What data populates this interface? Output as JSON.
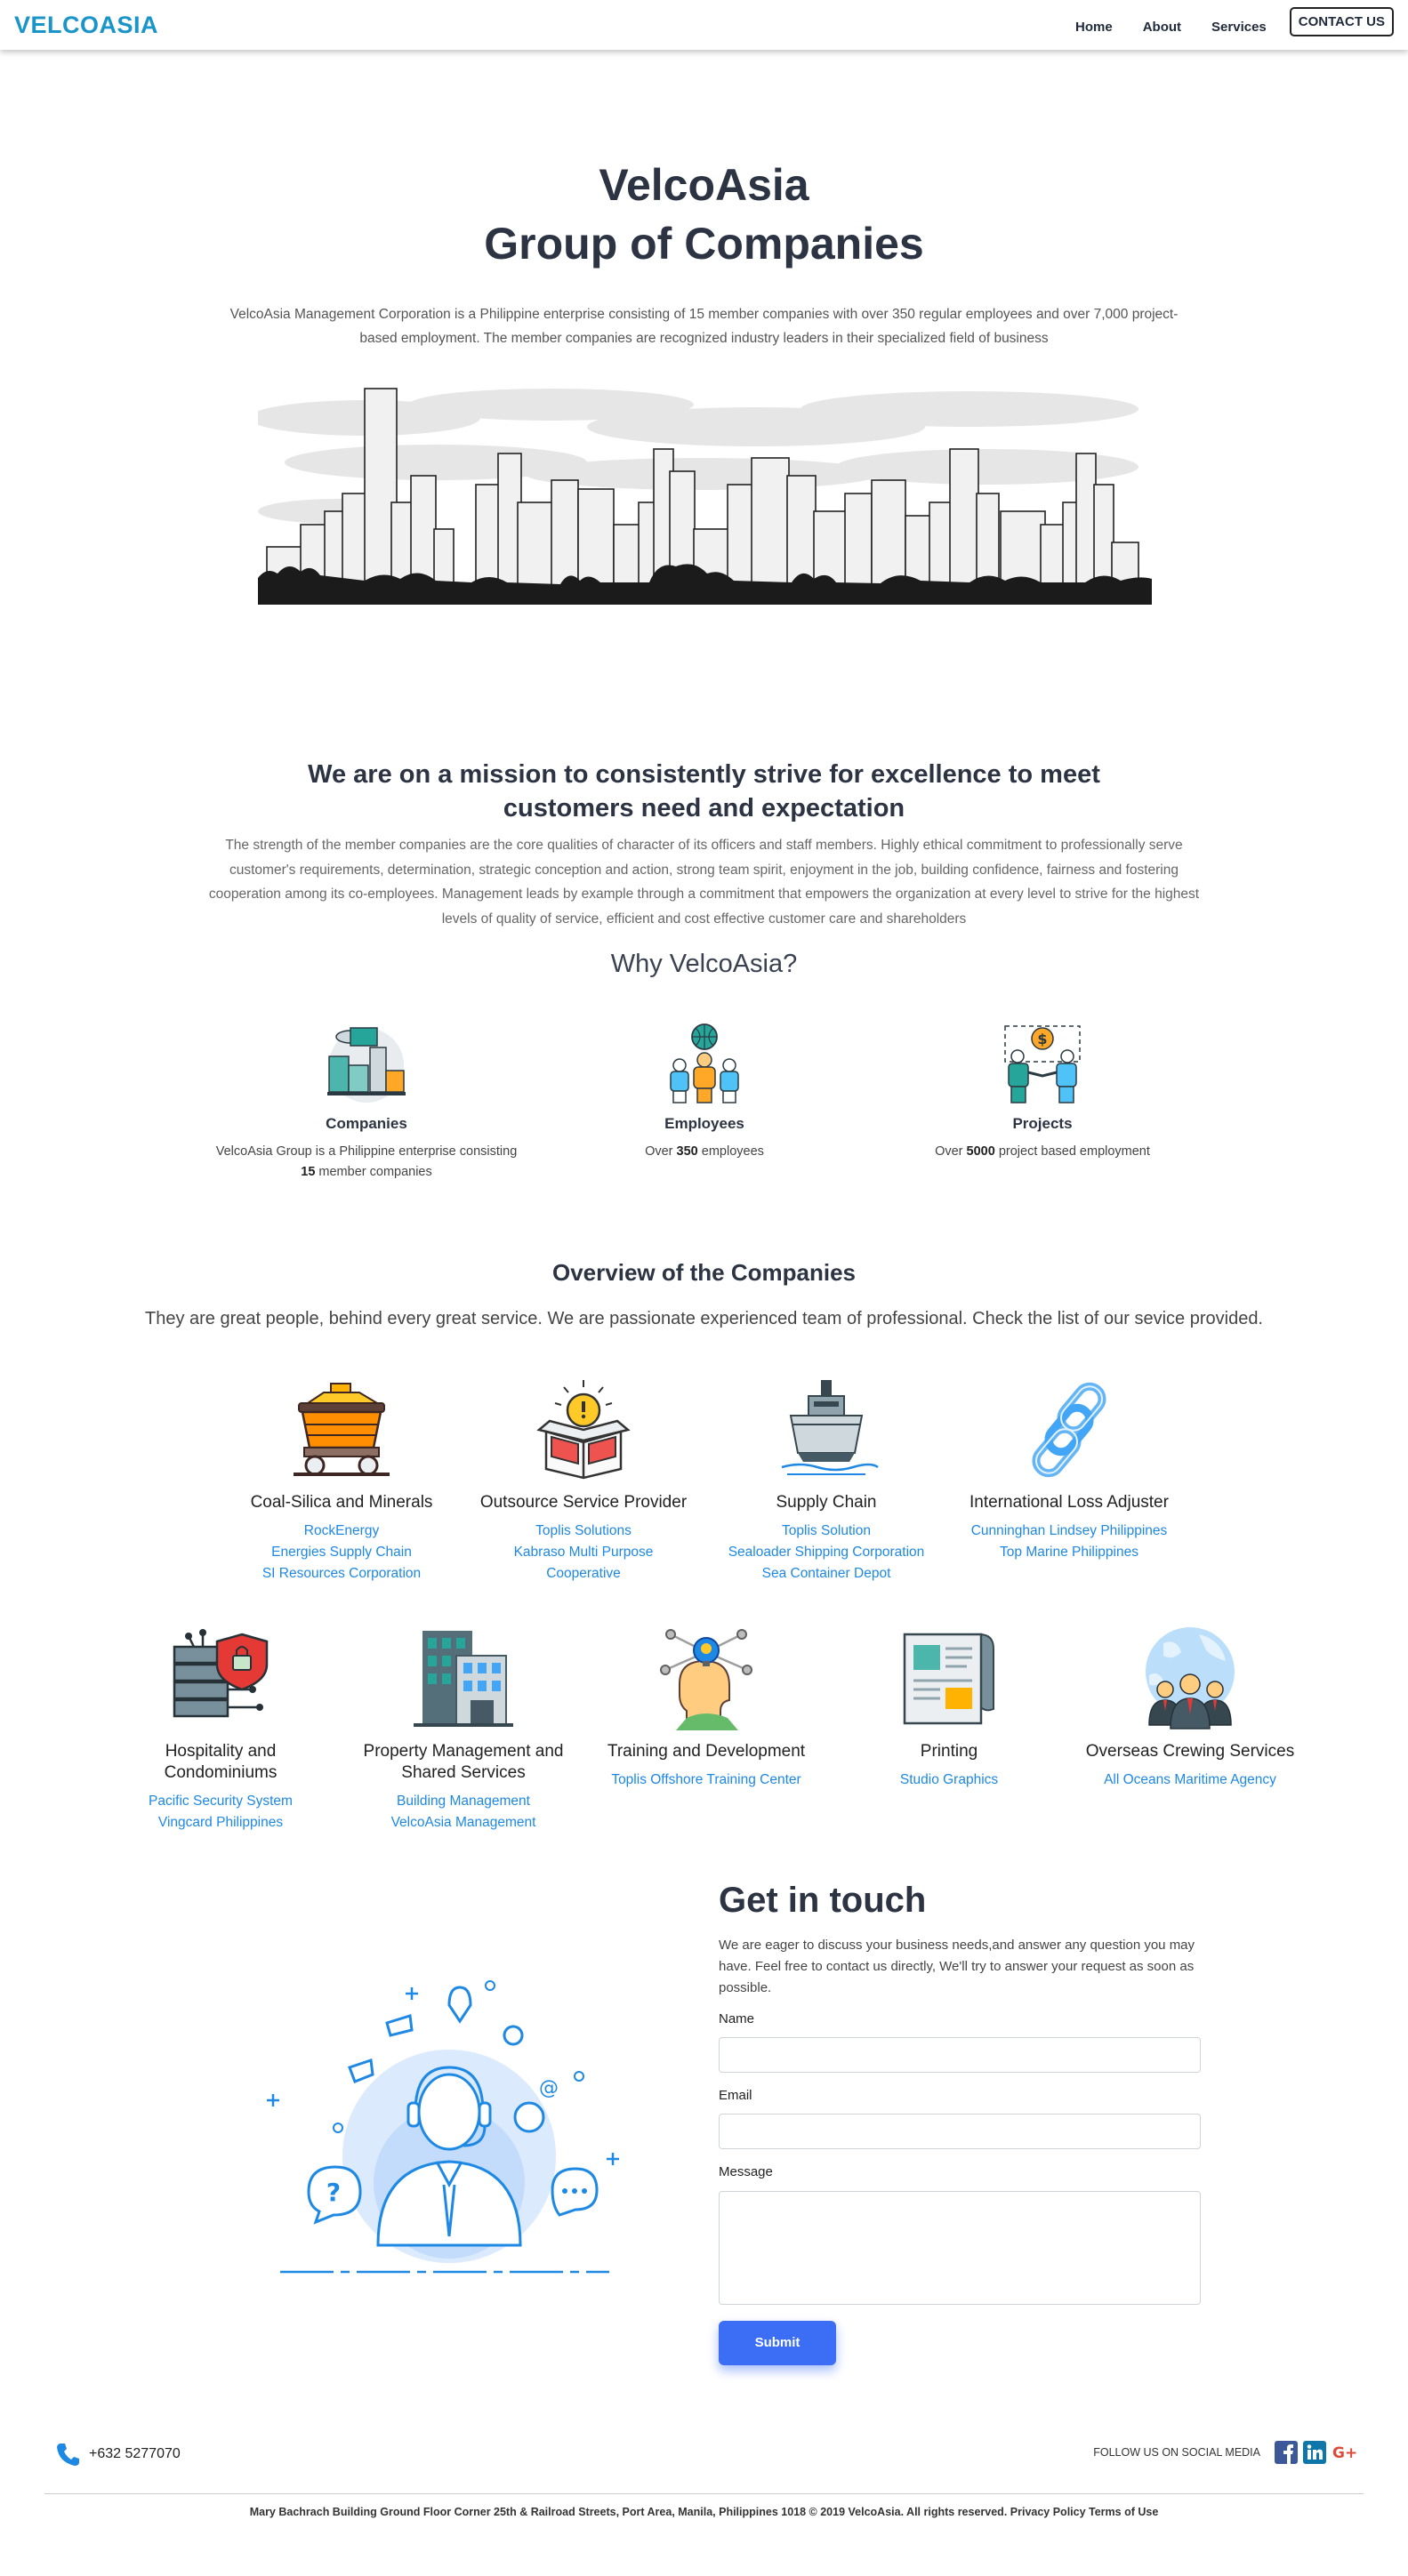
{
  "nav": {
    "brand": "VELCOASIA",
    "links": [
      "Home",
      "About",
      "Services"
    ],
    "contact_label": "CONTACT US"
  },
  "hero": {
    "title_line1": "VelcoAsia",
    "title_line2": "Group of Companies",
    "description": "VelcoAsia Management Corporation is a Philippine enterprise consisting of 15 member companies with over 350 regular employees and over 7,000 project-based employment. The member companies are recognized industry leaders in their specialized field of business"
  },
  "mission": {
    "title": "We are on a mission to consistently strive for excellence to meet customers need and expectation",
    "text": "The strength of the member companies are the core qualities of character of its officers and staff members. Highly ethical commitment to professionally serve customer's requirements, determination, strategic conception and action, strong team spirit, enjoyment in the job, building confidence, fairness and fostering cooperation among its co-employees. Management leads by example through a commitment that empowers the organization at every level to strive for the highest levels of quality of service, efficient and cost effective customer care and shareholders"
  },
  "why": {
    "title": "Why VelcoAsia?",
    "items": [
      {
        "label": "Companies",
        "text_pre": "VelcoAsia Group is a Philippine enterprise consisting",
        "bold": "15",
        "text_post": " member companies"
      },
      {
        "label": "Employees",
        "text_pre": "Over ",
        "bold": "350",
        "text_post": " employees"
      },
      {
        "label": "Projects",
        "text_pre": "Over ",
        "bold": "5000",
        "text_post": " project based employment"
      }
    ]
  },
  "overview": {
    "title": "Overview of the Companies",
    "subtitle": "They are great people, behind every great service. We are passionate experienced team of professional. Check the list of our sevice provided.",
    "services": [
      {
        "title": "Coal-Silica and Minerals",
        "icon": "mining-cart-icon",
        "links": [
          "RockEnergy",
          "Energies Supply Chain",
          "SI Resources Corporation"
        ]
      },
      {
        "title": "Outsource Service Provider",
        "icon": "idea-box-icon",
        "links": [
          "Toplis Solutions",
          "Kabraso Multi Purpose Cooperative"
        ]
      },
      {
        "title": "Supply Chain",
        "icon": "ship-icon",
        "links": [
          "Toplis Solution",
          "Sealoader Shipping Corporation",
          "Sea Container Depot"
        ]
      },
      {
        "title": "International Loss Adjuster",
        "icon": "chain-link-icon",
        "links": [
          "Cunninghan Lindsey Philippines",
          "Top Marine Philippines"
        ]
      },
      {
        "title": "Hospitality and Condominiums",
        "icon": "server-security-icon",
        "links": [
          "Pacific Security System",
          "Vingcard Philippines"
        ]
      },
      {
        "title": "Property Management and Shared Services",
        "icon": "building-icon",
        "links": [
          "Building Management",
          "VelcoAsia Management"
        ]
      },
      {
        "title": "Training and Development",
        "icon": "head-idea-icon",
        "links": [
          "Toplis Offshore Training Center"
        ]
      },
      {
        "title": "Printing",
        "icon": "printing-paper-icon",
        "links": [
          "Studio Graphics"
        ]
      },
      {
        "title": "Overseas Crewing Services",
        "icon": "global-team-icon",
        "links": [
          "All Oceans Maritime Agency"
        ]
      }
    ]
  },
  "contact": {
    "title": "Get in touch",
    "text": "We are eager to discuss your business needs,and answer any question you may have. Feel free to contact us directly, We'll try to answer your request as soon as possible.",
    "name_label": "Name",
    "email_label": "Email",
    "message_label": "Message",
    "submit_label": "Submit"
  },
  "footer": {
    "phone": "+632 5277070",
    "follow_label": "FOLLOW US ON SOCIAL MEDIA",
    "address": "Mary Bachrach Building Ground Floor Corner 25th & Railroad Streets, Port Area, Manila, Philippines 1018 © 2019 VelcoAsia. All rights reserved. Privacy Policy Terms of Use"
  },
  "colors": {
    "brand": "#1a95c9",
    "link": "#1e88e5",
    "submit": "#3b6ef5",
    "heading": "#2c3342"
  }
}
